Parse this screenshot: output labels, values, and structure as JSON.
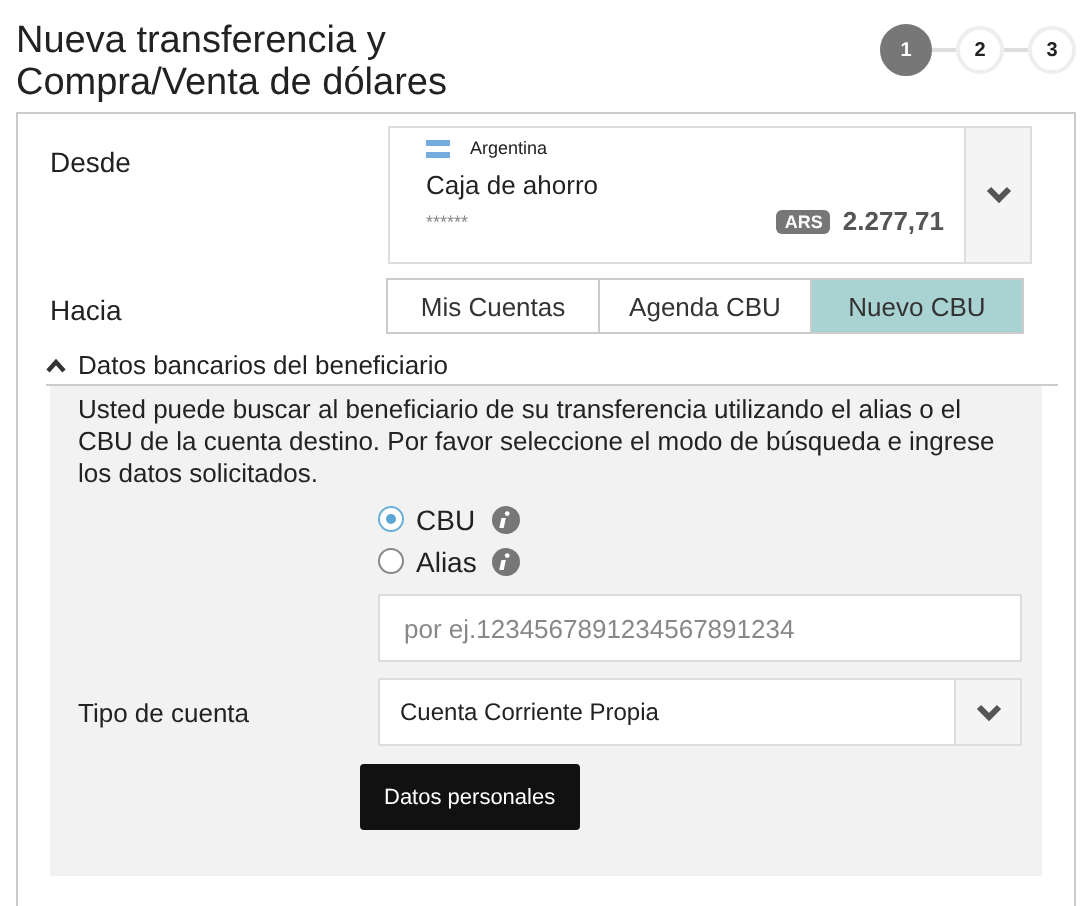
{
  "title": "Nueva transferencia y Compra/Venta de dólares",
  "steps": [
    {
      "label": "1",
      "selected": true
    },
    {
      "label": "2",
      "selected": false
    },
    {
      "label": "3",
      "selected": false
    }
  ],
  "from": {
    "label": "Desde",
    "country": "Argentina",
    "account_type": "Caja de ahorro",
    "account_number": "******",
    "currency": "ARS",
    "balance": "2.277,71"
  },
  "to": {
    "label": "Hacia",
    "tabs": [
      {
        "label": "Mis Cuentas",
        "selected": false
      },
      {
        "label": "Agenda CBU",
        "selected": false
      },
      {
        "label": "Nuevo CBU",
        "selected": true
      }
    ]
  },
  "section": {
    "title": "Datos bancarios del beneficiario",
    "expanded": true,
    "description": "Usted puede buscar al beneficiario de su transferencia utilizando el alias o el CBU de la cuenta destino. Por favor seleccione el modo de búsqueda e ingrese los datos solicitados.",
    "options": [
      {
        "label": "CBU",
        "selected": true
      },
      {
        "label": "Alias",
        "selected": false
      }
    ],
    "search": {
      "placeholder": "por ej.1234567891234567891234"
    },
    "account_type": {
      "label": "Tipo de cuenta",
      "value": "Cuenta Corriente Propia"
    },
    "button": "Datos personales"
  }
}
